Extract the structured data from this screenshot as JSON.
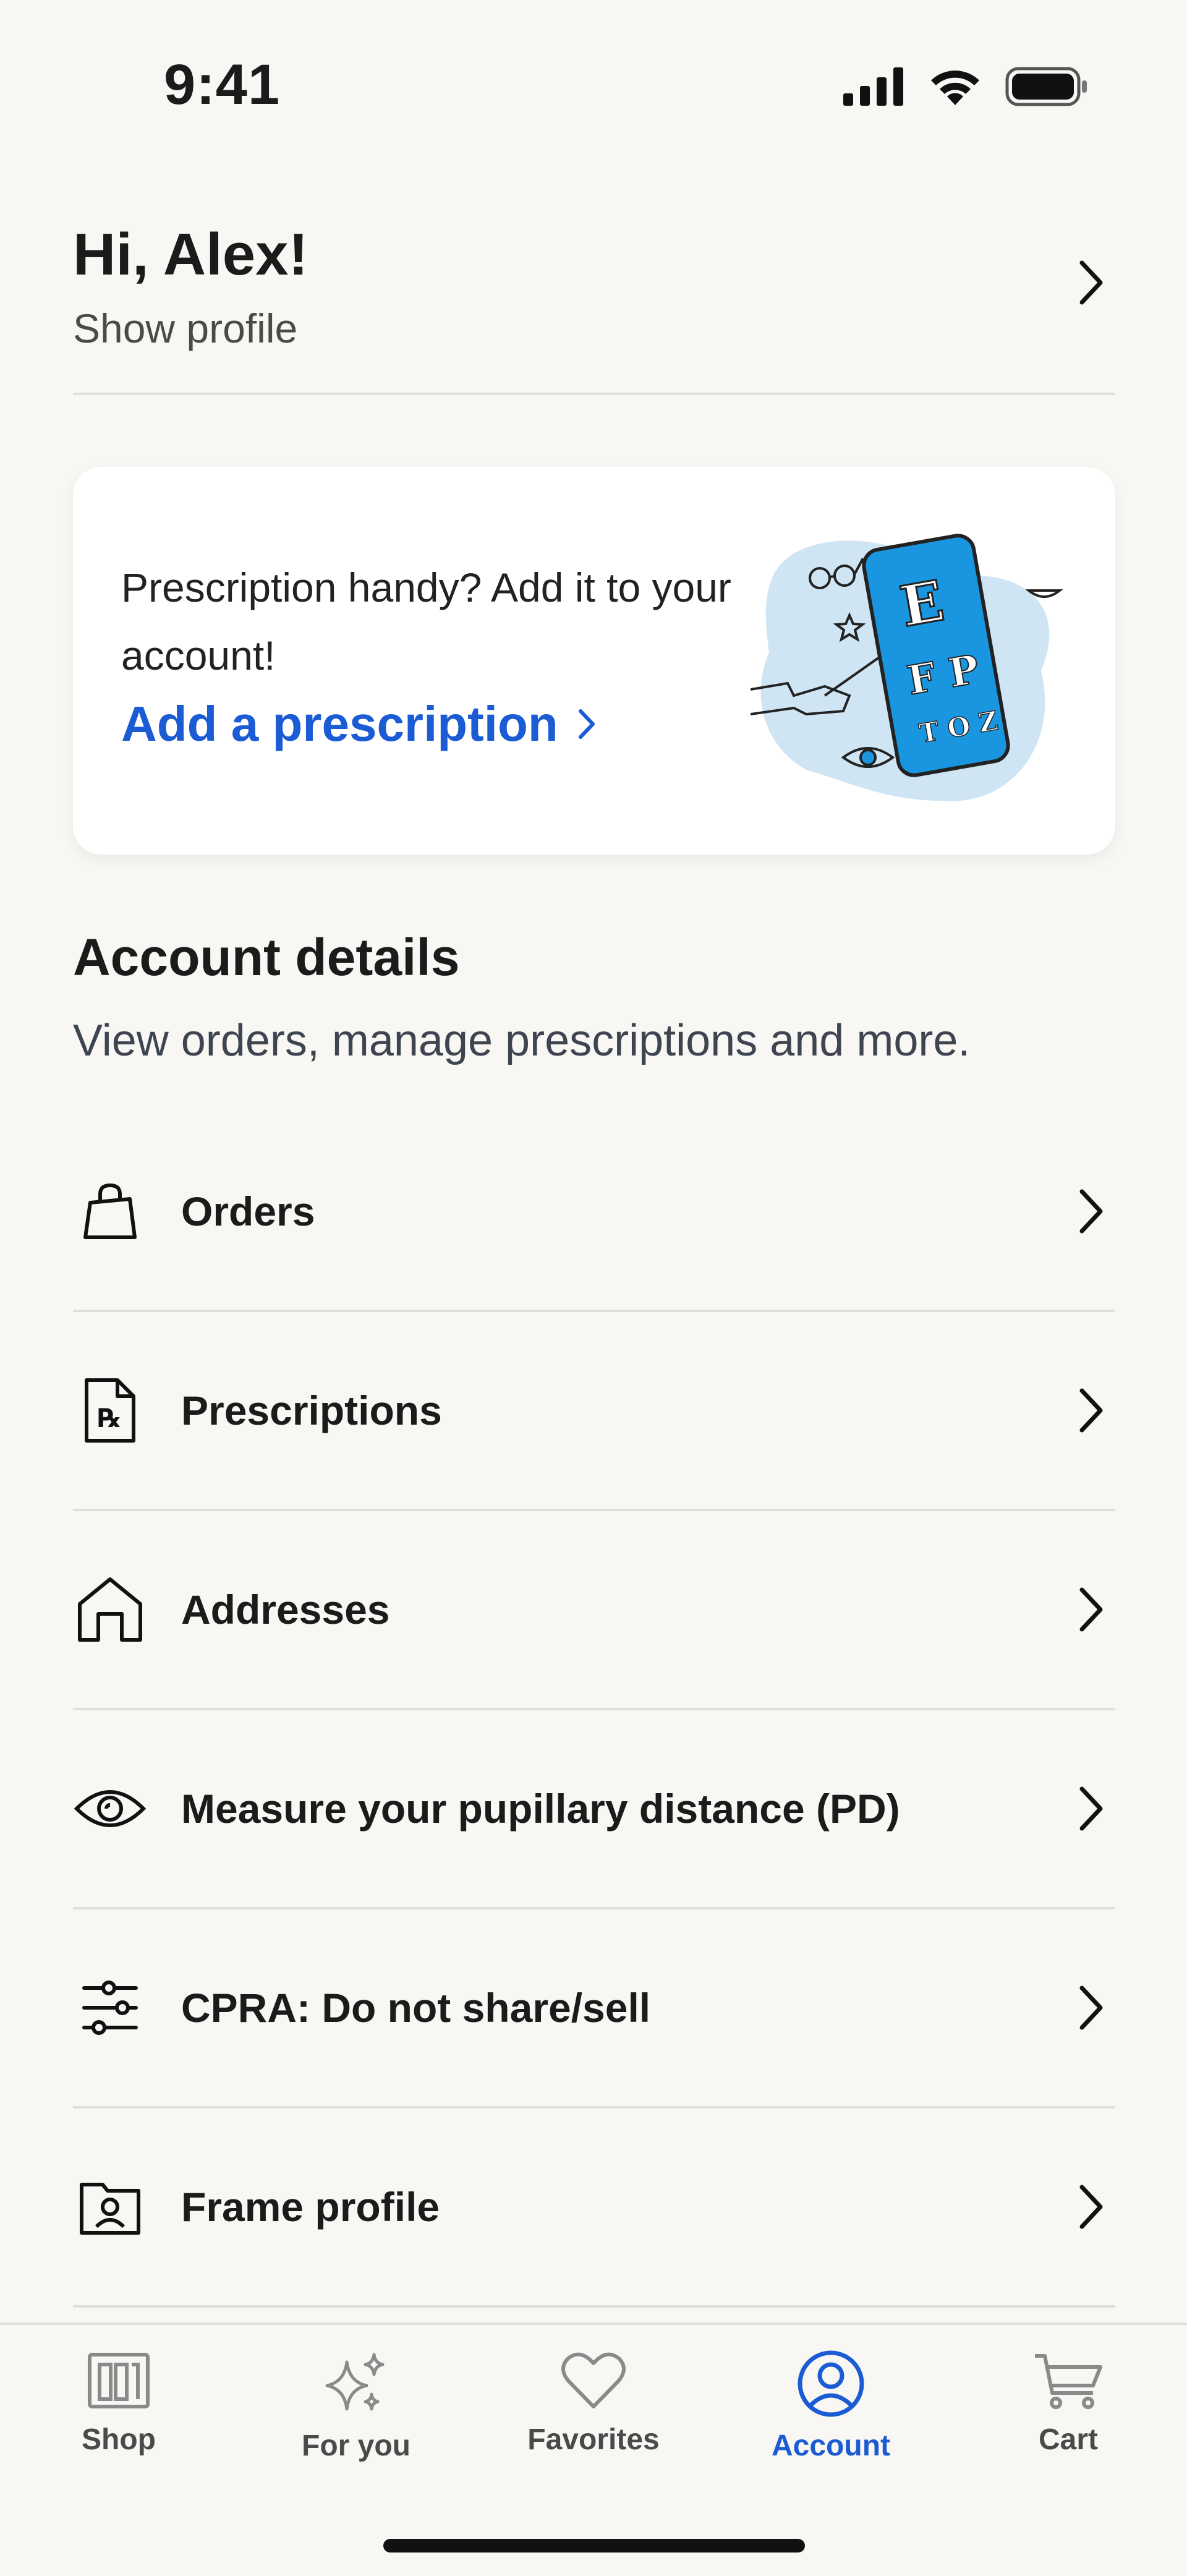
{
  "status_bar": {
    "time": "9:41"
  },
  "header": {
    "greeting": "Hi, Alex!",
    "subtitle": "Show profile"
  },
  "promo": {
    "text": "Prescription handy? Add it to your account!",
    "link_label": "Add a prescription",
    "illustration": {
      "chart_letters": [
        "E",
        "F P",
        "T O Z"
      ]
    },
    "colors": {
      "link": "#1b5bd4",
      "phone": "#1a96e0",
      "blob": "#cfe5f3"
    }
  },
  "account_details": {
    "title": "Account details",
    "subtitle": "View orders, manage prescriptions and more."
  },
  "menu": {
    "items": [
      {
        "label": "Orders",
        "icon": "shopping-bag-icon"
      },
      {
        "label": "Prescriptions",
        "icon": "rx-document-icon"
      },
      {
        "label": "Addresses",
        "icon": "house-icon"
      },
      {
        "label": "Measure your pupillary distance (PD)",
        "icon": "eye-icon"
      },
      {
        "label": "CPRA: Do not share/sell",
        "icon": "sliders-icon"
      },
      {
        "label": "Frame profile",
        "icon": "face-folder-icon"
      }
    ]
  },
  "tab_bar": {
    "tabs": [
      {
        "label": "Shop",
        "icon": "shop-icon",
        "active": false
      },
      {
        "label": "For you",
        "icon": "sparkles-icon",
        "active": false
      },
      {
        "label": "Favorites",
        "icon": "heart-icon",
        "active": false
      },
      {
        "label": "Account",
        "icon": "account-icon",
        "active": true
      },
      {
        "label": "Cart",
        "icon": "cart-icon",
        "active": false
      }
    ],
    "colors": {
      "active": "#1b5bd4",
      "inactive": "#8a8a8a"
    }
  }
}
